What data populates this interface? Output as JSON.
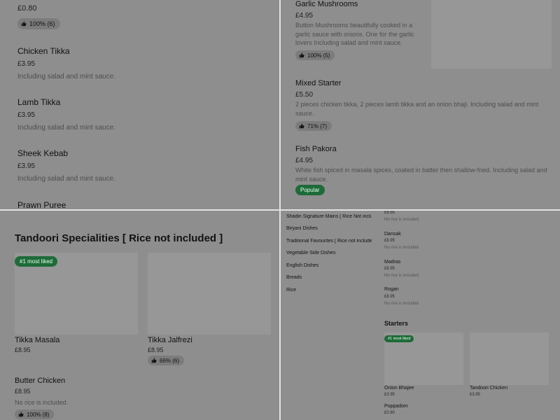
{
  "q1": {
    "top_price": "£0.80",
    "top_rating": "100% (6)",
    "items": [
      {
        "name": "Chicken Tikka",
        "price": "£3.95",
        "desc": "Including salad and mint sauce."
      },
      {
        "name": "Lamb Tikka",
        "price": "£3.95",
        "desc": "Including salad and mint sauce."
      },
      {
        "name": "Sheek Kebab",
        "price": "£3.95",
        "desc": "Including salad and mint sauce."
      },
      {
        "name": "Prawn Puree"
      }
    ]
  },
  "q2": {
    "garlic": {
      "name": "Garlic Mushrooms",
      "price": "£4.95",
      "desc": "Button Mushrooms beautifully cooked in a garlic sauce with onions. One for the garlic lovers Including salad and mint sauce.",
      "rating": "100% (5)"
    },
    "mixed": {
      "name": "Mixed Starter",
      "price": "£5.50",
      "desc": "2 pieces chicken tikka, 2 pieces lamb tikka and an onion bhaji. Including salad and mint sauce.",
      "rating": "71% (7)"
    },
    "fish": {
      "name": "Fish Pakora",
      "price": "£4.95",
      "desc": "White fish spiced in masala spices, coated in batter then shallow-fried. Including salad and mint sauce.",
      "badge": "Popular"
    }
  },
  "q3": {
    "section_title": "Tandoori Specialities [ Rice not included ]",
    "card1": {
      "badge": "#1 most liked",
      "name": "Tikka Masala",
      "price": "£8.95"
    },
    "card2": {
      "name": "Tikka Jalfrezi",
      "price": "£8.95",
      "rating": "66% (6)"
    },
    "item3": {
      "name": "Butter Chicken",
      "price": "£8.95",
      "desc": "No rice is included.",
      "rating": "100% (8)"
    }
  },
  "q4": {
    "sidebar": [
      "Shadin Signature Mains [ Rice Not includ",
      "Biryani Dishes",
      "Traditional Favourites [ Rice not include",
      "Vegetable Side Dishes",
      "English Dishes",
      "Breads",
      "Rice"
    ],
    "top_price": "£8.95",
    "top_desc": "No rice is included",
    "mains": [
      {
        "name": "Dansak",
        "price": "£8.95",
        "desc": "No rice is included"
      },
      {
        "name": "Madras",
        "price": "£8.95",
        "desc": "No rice is included"
      },
      {
        "name": "Rogan",
        "price": "£8.95",
        "desc": "No rice is included"
      }
    ],
    "starters_title": "Starters",
    "card1": {
      "badge": "#1 most liked",
      "name": "Onion Bhajee",
      "price": "£3.95"
    },
    "card2": {
      "name": "Tandoori Chicken",
      "price": "£3.95"
    },
    "poppadom": {
      "name": "Poppadom",
      "price": "£0.80"
    }
  }
}
